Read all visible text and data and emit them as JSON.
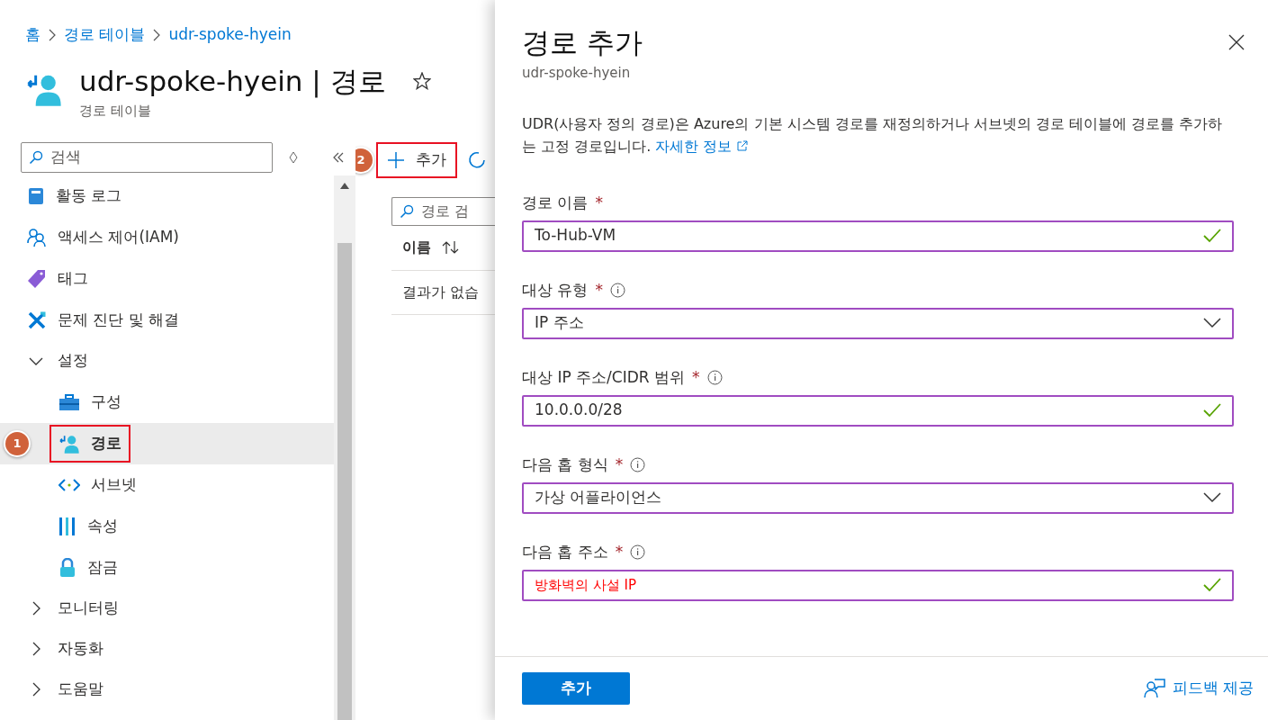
{
  "breadcrumb": [
    {
      "label": "홈"
    },
    {
      "label": "경로 테이블"
    },
    {
      "label": "udr-spoke-hyein"
    }
  ],
  "page": {
    "title": "udr-spoke-hyein | 경로",
    "subtitle": "경로 테이블",
    "favorite": false
  },
  "sidebar": {
    "search": {
      "placeholder": "검색"
    },
    "items": [
      {
        "label": "활동 로그",
        "selected": false
      },
      {
        "label": "액세스 제어(IAM)",
        "selected": false
      },
      {
        "label": "태그",
        "selected": false
      },
      {
        "label": "문제 진단 및 해결",
        "selected": false
      },
      {
        "label": "설정",
        "expanded": true,
        "children": [
          {
            "label": "구성",
            "selected": false
          },
          {
            "label": "경로",
            "selected": true,
            "marker": "1"
          },
          {
            "label": "서브넷",
            "selected": false
          },
          {
            "label": "속성",
            "selected": false
          },
          {
            "label": "잠금",
            "selected": false
          }
        ]
      },
      {
        "label": "모니터링",
        "expanded": false
      },
      {
        "label": "자동화",
        "expanded": false
      },
      {
        "label": "도움말",
        "expanded": false
      }
    ]
  },
  "toolbar": {
    "add": {
      "label": "추가",
      "marker": "2"
    }
  },
  "table": {
    "search": {
      "placeholder": "경로 검"
    },
    "columns": [
      {
        "label": "이름"
      }
    ],
    "empty_text": "결과가 없습"
  },
  "panel": {
    "title": "경로 추가",
    "subtitle": "udr-spoke-hyein",
    "description": "UDR(사용자 정의 경로)은 Azure의 기본 시스템 경로를 재정의하거나 서브넷의 경로 테이블에 경로를 추가하는 고정 경로입니다.",
    "link": "자세한 정보",
    "fields": [
      {
        "label": "경로 이름",
        "required_mark": "*",
        "kind": "text",
        "value": "To-Hub-VM",
        "valid": true,
        "emphasized": false
      },
      {
        "label": "대상 유형",
        "required_mark": "*",
        "info": true,
        "kind": "select",
        "value": "IP 주소",
        "emphasized": false
      },
      {
        "label": "대상 IP 주소/CIDR 범위",
        "required_mark": "*",
        "info": true,
        "kind": "text",
        "value": "10.0.0.0/28",
        "valid": true,
        "emphasized": false
      },
      {
        "label": "다음 홉 형식",
        "required_mark": "*",
        "info": true,
        "kind": "select",
        "value": "가상 어플라이언스",
        "emphasized": false
      },
      {
        "label": "다음 홉 주소",
        "required_mark": "*",
        "info": true,
        "kind": "text",
        "value": "방화벽의 사설 IP",
        "valid": true,
        "emphasized": true
      }
    ],
    "submit": "추가",
    "feedback": "피드백 제공"
  }
}
